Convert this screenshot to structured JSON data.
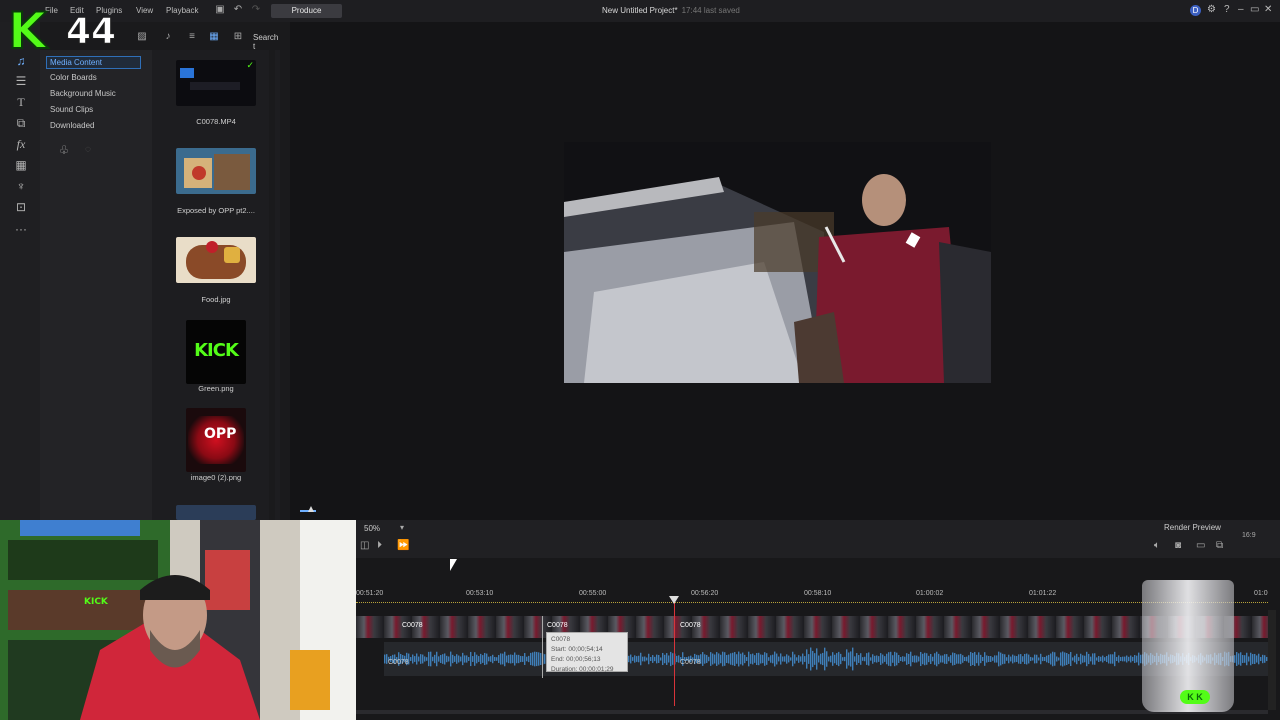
{
  "menu": {
    "items": [
      "File",
      "Edit",
      "Plugins",
      "View",
      "Playback"
    ],
    "produce_label": "Produce"
  },
  "project": {
    "title": "New Untitled Project*",
    "saved_status": "17:44 last saved"
  },
  "overlay_logo": {
    "letter": "K",
    "number": "44"
  },
  "library_toolbar": {
    "search_label": "Search t"
  },
  "categories": [
    "Media Content",
    "Color Boards",
    "Background Music",
    "Sound Clips",
    "Downloaded"
  ],
  "media": [
    {
      "label": "C0078.MP4"
    },
    {
      "label": "Exposed by OPP pt2...."
    },
    {
      "label": "Food.jpg"
    },
    {
      "label": "Green.png",
      "text": "KICK"
    },
    {
      "label": "image0 (2).png",
      "text": "OPP"
    }
  ],
  "preview_controls": {
    "zoom": "50%",
    "render_preview": "Render Preview",
    "aspect": "16:9"
  },
  "timeline": {
    "ruler": [
      "00:51:20",
      "00:53:10",
      "00:55:00",
      "00:56:20",
      "00:58:10",
      "01:00:02",
      "01:01:22",
      "01:0"
    ],
    "clip_name": "C0078",
    "tooltip": {
      "name": "C0078",
      "start": "Start: 00;00;54;14",
      "end": "End: 00;00;56;13",
      "duration": "Duration: 00;00;01;29"
    }
  },
  "webcam": {
    "badge": "KICK"
  },
  "colors": {
    "accent_blue": "#2f6fb8",
    "kick_green": "#53fc18",
    "playhead_red": "#d8343a",
    "audio_wave": "#3f7fb8"
  }
}
